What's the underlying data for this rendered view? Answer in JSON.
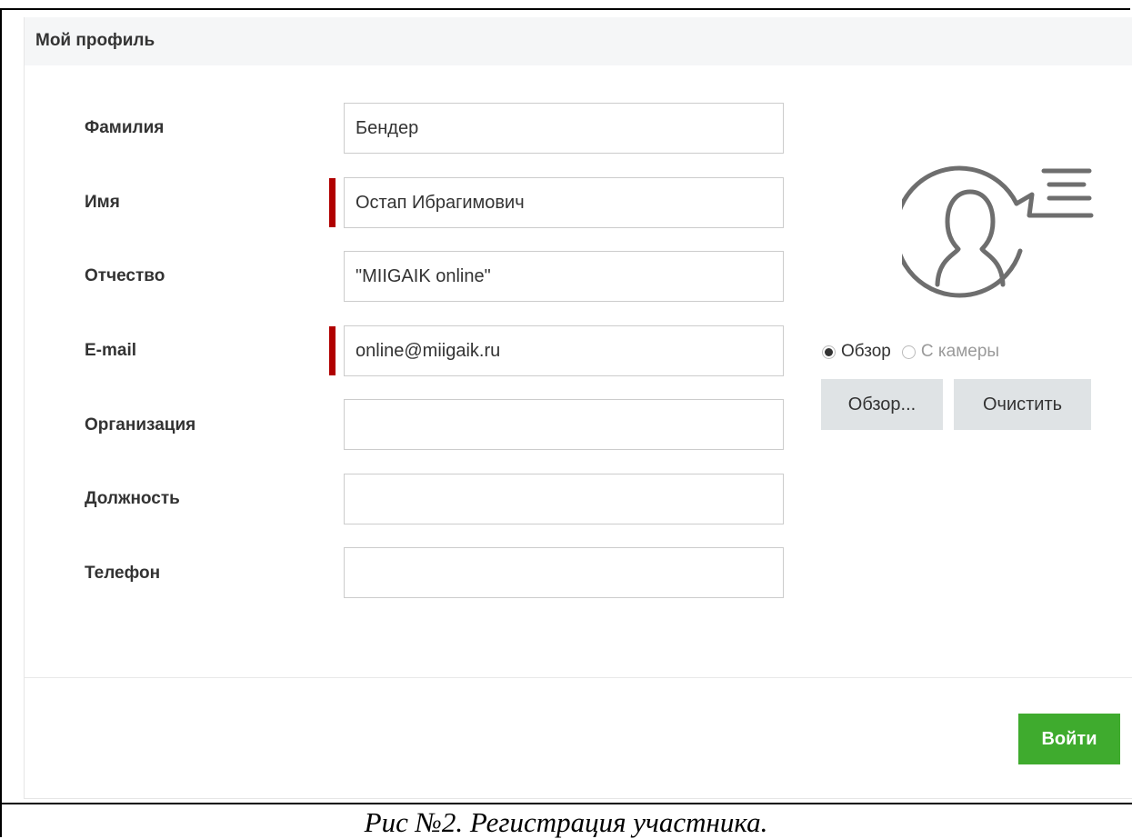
{
  "panel": {
    "title": "Мой профиль"
  },
  "form": {
    "fields": [
      {
        "label": "Фамилия",
        "value": "Бендер",
        "required": false
      },
      {
        "label": "Имя",
        "value": "Остап Ибрагимович",
        "required": true
      },
      {
        "label": "Отчество",
        "value": "\"MIIGAIK online\"",
        "required": false
      },
      {
        "label": "E-mail",
        "value": "online@miigaik.ru",
        "required": true
      },
      {
        "label": "Организация",
        "value": "",
        "required": false
      },
      {
        "label": "Должность",
        "value": "",
        "required": false
      },
      {
        "label": "Телефон",
        "value": "",
        "required": false
      }
    ]
  },
  "photo": {
    "avatar_icon": "user-profile-icon",
    "source_options": [
      {
        "label": "Обзор",
        "selected": true
      },
      {
        "label": "С камеры",
        "selected": false
      }
    ],
    "browse_label": "Обзор...",
    "clear_label": "Очистить"
  },
  "footer": {
    "submit_label": "Войти"
  },
  "caption": "Рис №2. Регистрация участника.",
  "colors": {
    "required_marker": "#b00000",
    "submit_button": "#3fab2e",
    "gray_button": "#dfe3e5",
    "header_bg": "#f5f6f7"
  }
}
